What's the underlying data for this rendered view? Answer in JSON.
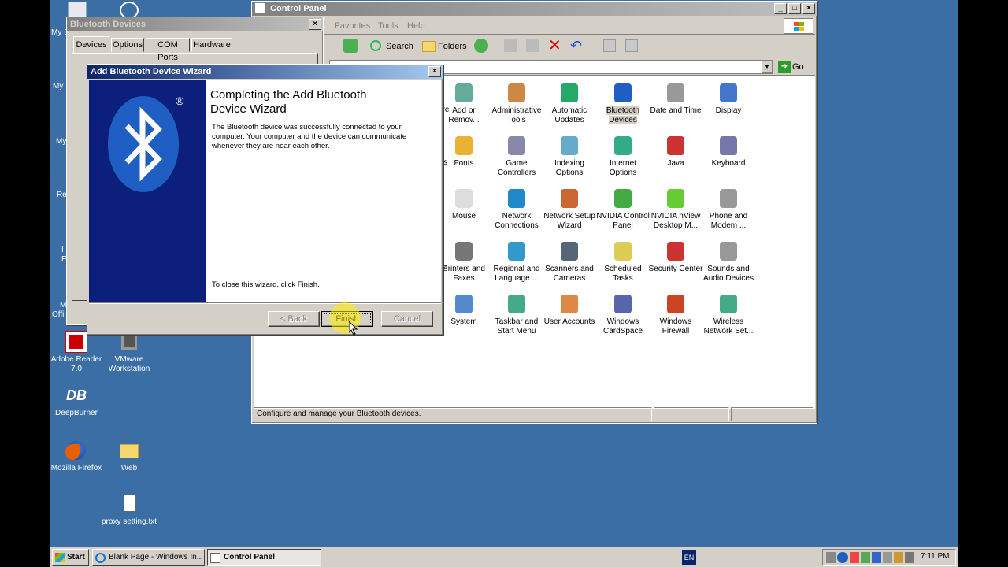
{
  "desktop": {
    "icons": [
      {
        "label": "Adobe Reader 7.0"
      },
      {
        "label": "VMware Workstation"
      },
      {
        "label": "DeepBurner"
      },
      {
        "label": "Mozilla Firefox"
      },
      {
        "label": "Web"
      },
      {
        "label": "proxy setting.txt"
      }
    ],
    "clipped_labels": [
      "My D",
      "My",
      "My",
      "Re",
      "I",
      "E",
      "M",
      "Offi"
    ]
  },
  "control_panel": {
    "title": "Control Panel",
    "menu": [
      "Favorites",
      "Tools",
      "Help"
    ],
    "toolbar": {
      "search": "Search",
      "folders": "Folders"
    },
    "go_label": "Go",
    "clipped_left": [
      "are",
      "ons",
      "ons"
    ],
    "items": [
      {
        "label": "Add or Remov..."
      },
      {
        "label": "Administrative Tools"
      },
      {
        "label": "Automatic Updates"
      },
      {
        "label": "Bluetooth Devices"
      },
      {
        "label": "Date and Time"
      },
      {
        "label": "Display"
      },
      {
        "label": "Fonts"
      },
      {
        "label": "Game Controllers"
      },
      {
        "label": "Indexing Options"
      },
      {
        "label": "Internet Options"
      },
      {
        "label": "Java"
      },
      {
        "label": "Keyboard"
      },
      {
        "label": "Mouse"
      },
      {
        "label": "Network Connections"
      },
      {
        "label": "Network Setup Wizard"
      },
      {
        "label": "NVIDIA Control Panel"
      },
      {
        "label": "NVIDIA nView Desktop M..."
      },
      {
        "label": "Phone and Modem ..."
      },
      {
        "label": "Printers and Faxes"
      },
      {
        "label": "Regional and Language ..."
      },
      {
        "label": "Scanners and Cameras"
      },
      {
        "label": "Scheduled Tasks"
      },
      {
        "label": "Security Center"
      },
      {
        "label": "Sounds and Audio Devices"
      },
      {
        "label": "System"
      },
      {
        "label": "Taskbar and Start Menu"
      },
      {
        "label": "User Accounts"
      },
      {
        "label": "Windows CardSpace"
      },
      {
        "label": "Windows Firewall"
      },
      {
        "label": "Wireless Network Set..."
      }
    ],
    "status": "Configure and manage your Bluetooth devices."
  },
  "bt_devices": {
    "title": "Bluetooth Devices",
    "tabs": [
      "Devices",
      "Options",
      "COM Ports",
      "Hardware"
    ]
  },
  "wizard": {
    "title": "Add Bluetooth Device Wizard",
    "heading": "Completing the Add Bluetooth Device Wizard",
    "body": "The Bluetooth device was successfully connected to your computer. Your computer and the device can communicate whenever they are near each other.",
    "close_hint": "To close this wizard, click Finish.",
    "back": "< Back",
    "finish": "Finish",
    "cancel": "Cancel",
    "logo_mark": "®"
  },
  "taskbar": {
    "start": "Start",
    "tasks": [
      {
        "label": "Blank Page - Windows In..."
      },
      {
        "label": "Control Panel"
      }
    ],
    "lang": "EN",
    "clock": "7:11 PM"
  },
  "colors": {
    "desktop": "#3a6ea5",
    "title_active": "#0a246a",
    "wizard_panel": "#0c1f7c",
    "bluetooth": "#1f5fc4"
  }
}
